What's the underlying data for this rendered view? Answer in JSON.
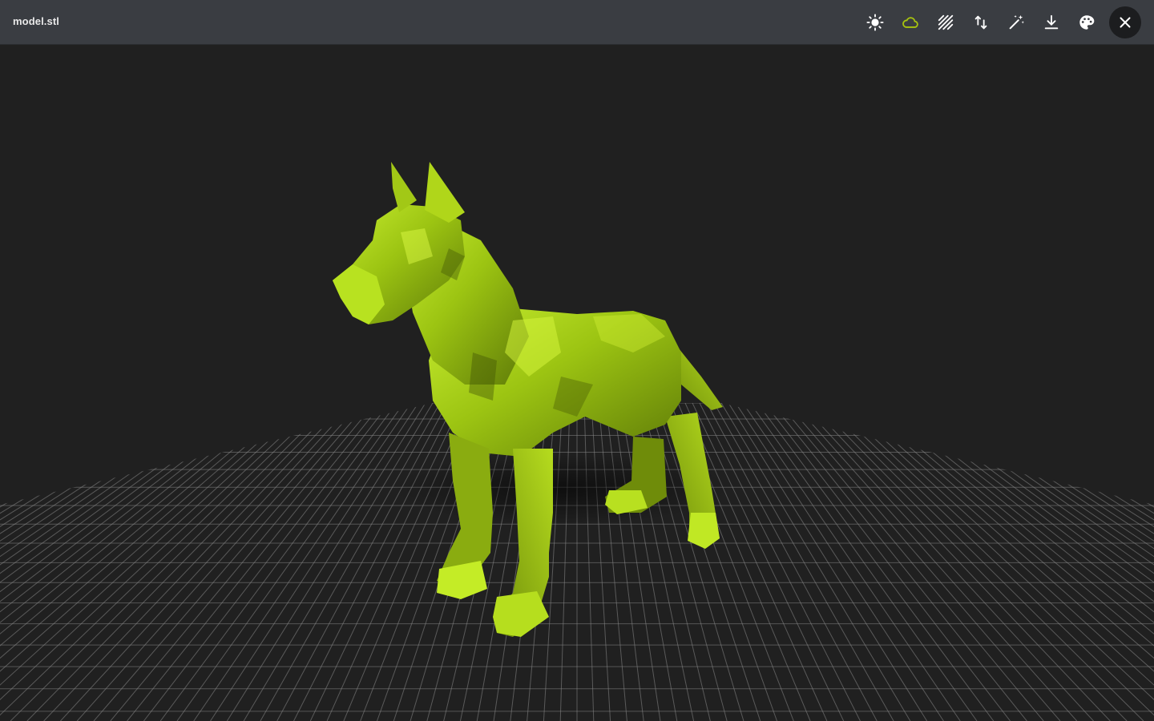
{
  "window": {
    "title": "model.stl"
  },
  "toolbar": {
    "buttons": [
      {
        "name": "lighting-button",
        "icon": "sun-icon"
      },
      {
        "name": "environment-button",
        "icon": "cloud-icon",
        "active": true
      },
      {
        "name": "wireframe-button",
        "icon": "hatch-stripes-icon"
      },
      {
        "name": "orientation-button",
        "icon": "up-down-arrows-icon"
      },
      {
        "name": "auto-fix-button",
        "icon": "magic-wand-icon"
      },
      {
        "name": "download-button",
        "icon": "download-icon"
      },
      {
        "name": "material-color-button",
        "icon": "palette-icon"
      },
      {
        "name": "close-button",
        "icon": "close-icon"
      }
    ]
  },
  "viewer": {
    "model_color": "#a8d414",
    "model_shadow_color": "#4a5e08",
    "grid_color": "#8a8a8a",
    "background_color": "#202020",
    "active_icon_color": "#a8c40e"
  }
}
